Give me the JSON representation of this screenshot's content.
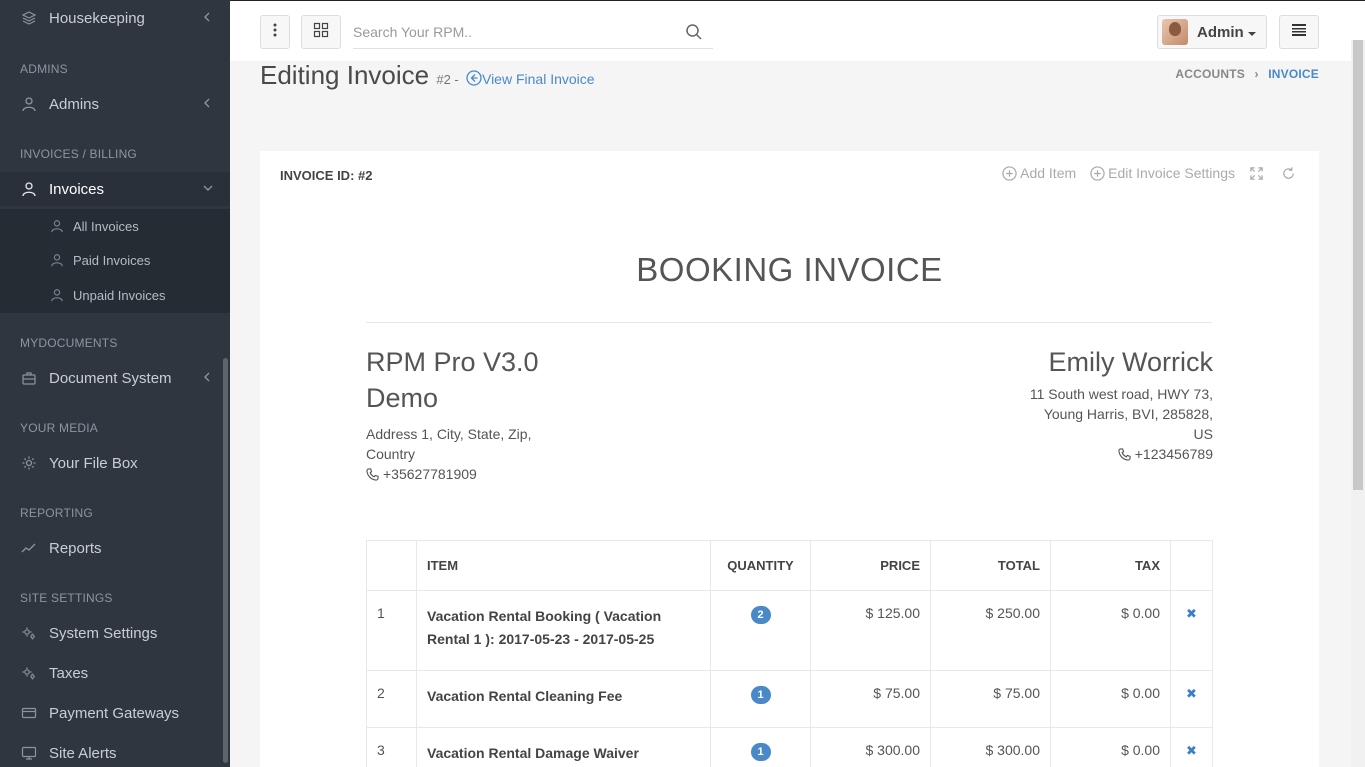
{
  "sidebar": {
    "housekeeping": "Housekeeping",
    "admins_head": "ADMINS",
    "admins": "Admins",
    "invoices_head": "INVOICES / BILLING",
    "invoices": "Invoices",
    "all_invoices": "All Invoices",
    "paid_invoices": "Paid Invoices",
    "unpaid_invoices": "Unpaid Invoices",
    "mydocuments_head": "MYDOCUMENTS",
    "document_system": "Document System",
    "media_head": "YOUR MEDIA",
    "file_box": "Your File Box",
    "reporting_head": "REPORTING",
    "reports": "Reports",
    "site_settings_head": "SITE SETTINGS",
    "system_settings": "System Settings",
    "taxes": "Taxes",
    "payment_gateways": "Payment Gateways",
    "site_alerts": "Site Alerts"
  },
  "topbar": {
    "search_placeholder": "Search Your RPM..",
    "user_name": "Admin"
  },
  "page": {
    "title": "Editing Invoice",
    "subtitle": "#2 -",
    "view_link": "View Final Invoice",
    "breadcrumb_1": "ACCOUNTS",
    "breadcrumb_2": "INVOICE"
  },
  "panel": {
    "title": "INVOICE ID: #2",
    "add_item": "Add Item",
    "edit_settings": "Edit Invoice Settings"
  },
  "invoice": {
    "heading": "BOOKING INVOICE",
    "from_name_1": "RPM Pro V3.0",
    "from_name_2": "Demo",
    "from_addr_1": "Address 1, City, State, Zip,",
    "from_addr_2": "Country",
    "from_phone": "+35627781909",
    "to_name": "Emily Worrick",
    "to_addr_1": "11 South west road, HWY 73,",
    "to_addr_2": "Young Harris, BVI, 285828,",
    "to_addr_3": "US",
    "to_phone": "+123456789"
  },
  "table": {
    "headers": [
      "",
      "ITEM",
      "QUANTITY",
      "PRICE",
      "TOTAL",
      "TAX",
      ""
    ],
    "rows": [
      {
        "n": "1",
        "item": "Vacation Rental Booking ( Vacation Rental 1 ): 2017-05-23 - 2017-05-25",
        "qty": "2",
        "price": "$ 125.00",
        "total": "$ 250.00",
        "tax": "$ 0.00"
      },
      {
        "n": "2",
        "item": "Vacation Rental Cleaning Fee",
        "qty": "1",
        "price": "$ 75.00",
        "total": "$ 75.00",
        "tax": "$ 0.00"
      },
      {
        "n": "3",
        "item": "Vacation Rental Damage Waiver",
        "qty": "1",
        "price": "$ 300.00",
        "total": "$ 300.00",
        "tax": "$ 0.00"
      }
    ]
  },
  "colors": {
    "sidebar_bg": "#2f3640",
    "accent": "#4a89c8"
  }
}
